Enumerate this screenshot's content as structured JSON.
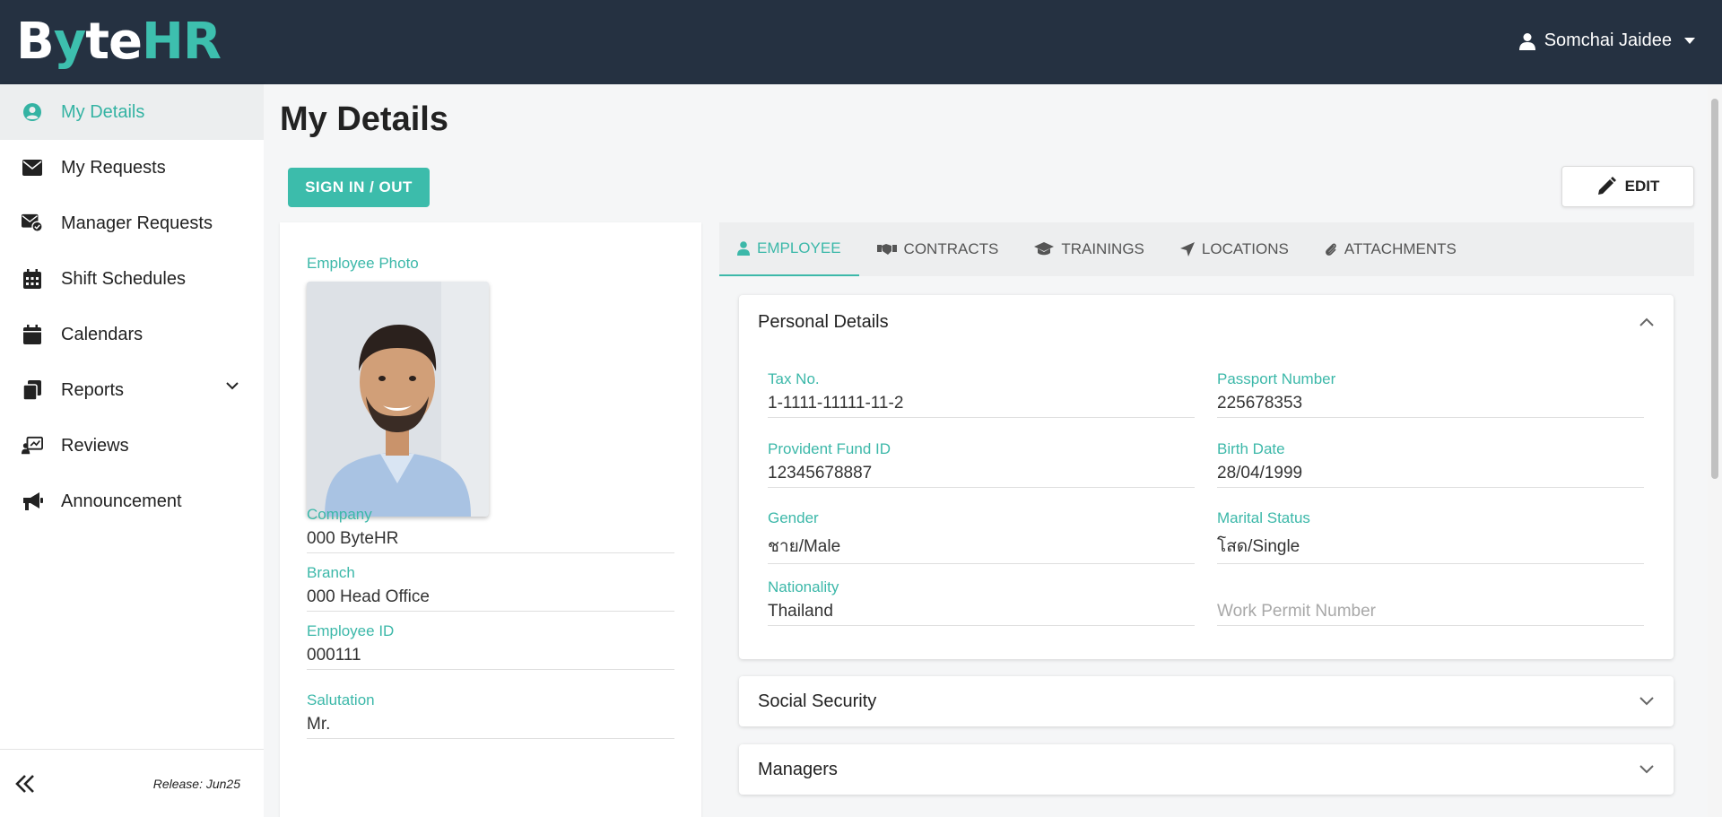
{
  "app": {
    "logo_part1": "B",
    "logo_part2": "y",
    "logo_part3": "te",
    "logo_part4": "HR",
    "user_name": "Somchai Jaidee"
  },
  "sidebar": {
    "items": [
      {
        "label": "My Details",
        "icon": "user-circle-icon"
      },
      {
        "label": "My Requests",
        "icon": "envelope-icon"
      },
      {
        "label": "Manager Requests",
        "icon": "envelope-check-icon"
      },
      {
        "label": "Shift Schedules",
        "icon": "calendar-grid-icon"
      },
      {
        "label": "Calendars",
        "icon": "calendar-icon"
      },
      {
        "label": "Reports",
        "icon": "copy-icon"
      },
      {
        "label": "Reviews",
        "icon": "chalkboard-user-icon"
      },
      {
        "label": "Announcement",
        "icon": "megaphone-icon"
      }
    ],
    "release": "Release: Jun25"
  },
  "page": {
    "title": "My Details",
    "sign_button": "SIGN IN / OUT",
    "edit_button": "EDIT"
  },
  "left": {
    "photo_label": "Employee Photo",
    "fields": [
      {
        "label": "Company",
        "value": "000 ByteHR"
      },
      {
        "label": "Branch",
        "value": "000 Head Office"
      },
      {
        "label": "Employee ID",
        "value": "000111"
      },
      {
        "label": "Salutation",
        "value": "Mr."
      }
    ]
  },
  "tabs": [
    {
      "label": "EMPLOYEE",
      "icon": "user-icon"
    },
    {
      "label": "CONTRACTS",
      "icon": "handshake-icon"
    },
    {
      "label": "TRAININGS",
      "icon": "graduation-cap-icon"
    },
    {
      "label": "LOCATIONS",
      "icon": "location-arrow-icon"
    },
    {
      "label": "ATTACHMENTS",
      "icon": "paperclip-icon"
    }
  ],
  "personal": {
    "title": "Personal Details",
    "fields": [
      {
        "label": "Tax No.",
        "value": "1-1111-11111-11-2"
      },
      {
        "label": "Passport Number",
        "value": "225678353"
      },
      {
        "label": "Provident Fund ID",
        "value": "12345678887"
      },
      {
        "label": "Birth Date",
        "value": "28/04/1999"
      },
      {
        "label": "Gender",
        "value": "ชาย/Male"
      },
      {
        "label": "Marital Status",
        "value": "โสด/Single"
      },
      {
        "label": "Nationality",
        "value": "Thailand"
      }
    ],
    "work_permit_placeholder": "Work Permit Number"
  },
  "sections": {
    "social_security": "Social Security",
    "managers": "Managers"
  },
  "colors": {
    "accent": "#3cb8a9",
    "topbar": "#253141"
  }
}
